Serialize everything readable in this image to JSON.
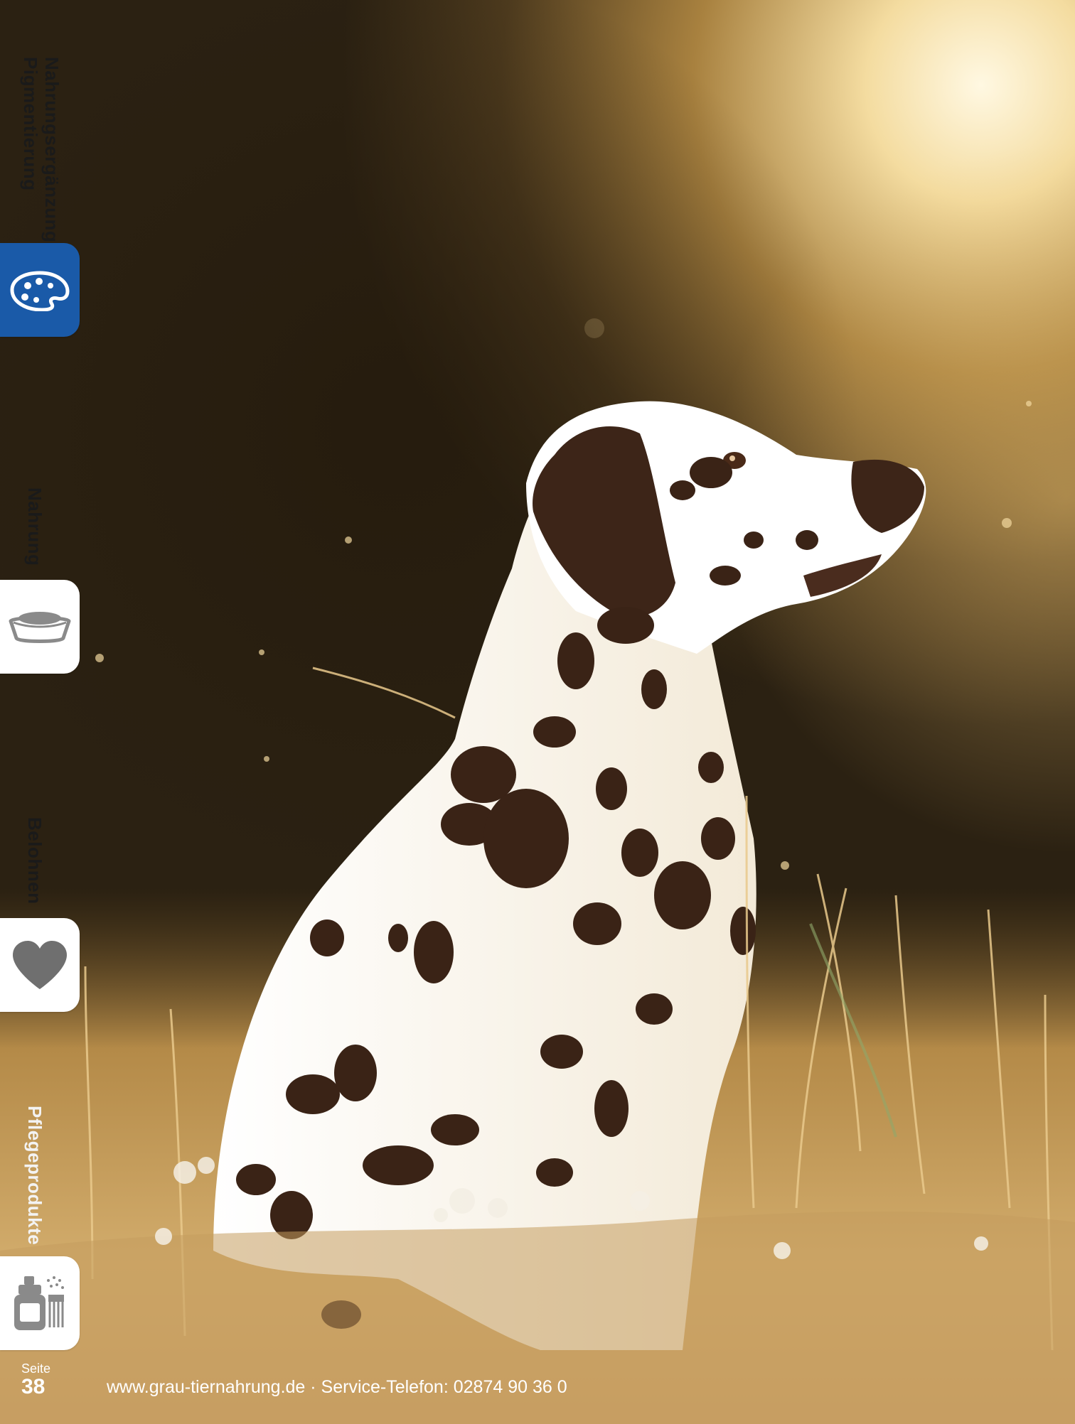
{
  "nav": {
    "tabs": [
      {
        "lines": [
          "Nahrungsergänzung",
          "Pigmentierung"
        ],
        "icon": "palette-icon",
        "active": true
      },
      {
        "lines": [
          "Nahrung"
        ],
        "icon": "food-bowl-icon",
        "active": false
      },
      {
        "lines": [
          "Belohnen"
        ],
        "icon": "heart-icon",
        "active": false
      },
      {
        "lines": [
          "Pflegeprodukte"
        ],
        "icon": "grooming-products-icon",
        "active": false
      }
    ]
  },
  "footer": {
    "page_label": "Seite",
    "page_number": "38",
    "contact": "www.grau-tiernahrung.de · Service-Telefon: 02874 90 36 0"
  },
  "colors": {
    "active_tab": "#1a5aa8",
    "tab_bg": "#ffffff",
    "icon_gray": "#8a8a8a"
  }
}
